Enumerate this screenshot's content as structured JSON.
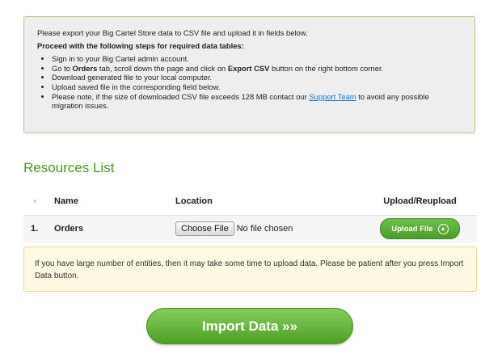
{
  "info": {
    "intro": "Please export your Big Cartel Store data to CSV file and upload it in fields below.",
    "steps_title": "Proceed with the following steps for required data tables:",
    "step1": "Sign in to your Big Cartel admin account.",
    "step2_a": "Go to ",
    "step2_tab": "Orders",
    "step2_b": " tab, scroll down the page and click on ",
    "step2_btn": "Export CSV",
    "step2_c": " button on the right bottom corner.",
    "step3": "Download generated file to your local computer.",
    "step4": "Upload saved file in the corresponding field below.",
    "step5_a": "Please note, if the size of downloaded CSV file exceeds 128 MB contact our ",
    "step5_link": "Support Team",
    "step5_b": " to avoid any possible migration issues."
  },
  "resources": {
    "title": "Resources List",
    "headers": {
      "sort": "▼",
      "name": "Name",
      "location": "Location",
      "upload": "Upload/Reupload"
    },
    "rows": [
      {
        "num": "1.",
        "name": "Orders",
        "choose_label": "Choose File",
        "file_status": "No file chosen",
        "upload_label": "Upload File",
        "upload_icon": "⊕"
      }
    ]
  },
  "notice": "If you have large number of entities, then it may take some time to upload data. Please be patient after you press Import Data button.",
  "import_button": "Import Data »»",
  "colors": {
    "accent_green": "#4e9a26",
    "button_green": "#5fb137",
    "link_blue": "#1a73c9",
    "notice_bg": "#fdf9e2",
    "info_border": "#a8d08d"
  }
}
